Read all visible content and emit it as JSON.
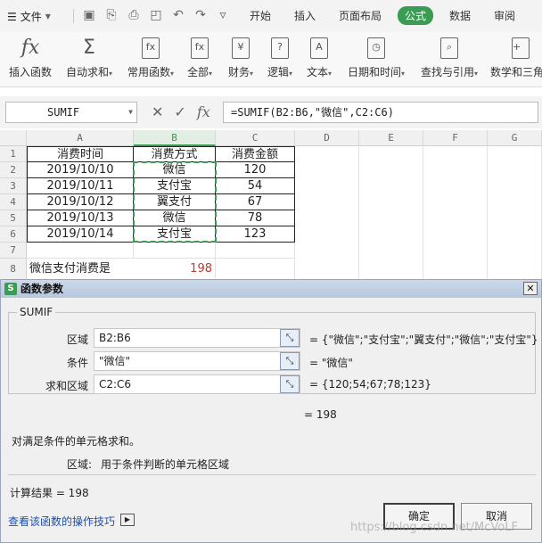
{
  "menubar": {
    "file_label": "文件",
    "tabs": [
      "开始",
      "插入",
      "页面布局",
      "公式",
      "数据",
      "审阅"
    ],
    "active_tab": "公式"
  },
  "ribbon": {
    "buttons": [
      {
        "label": "插入函数",
        "icon": "fx-icon"
      },
      {
        "label": "自动求和",
        "icon": "sigma-icon"
      },
      {
        "label": "常用函数",
        "icon": "star-function-icon"
      },
      {
        "label": "全部",
        "icon": "all-functions-icon"
      },
      {
        "label": "财务",
        "icon": "finance-icon"
      },
      {
        "label": "逻辑",
        "icon": "logic-icon"
      },
      {
        "label": "文本",
        "icon": "text-function-icon"
      },
      {
        "label": "日期和时间",
        "icon": "clock-icon"
      },
      {
        "label": "查找与引用",
        "icon": "lookup-icon"
      },
      {
        "label": "数学和三角",
        "icon": "math-icon"
      }
    ]
  },
  "formula_bar": {
    "name_box": "SUMIF",
    "formula": "=SUMIF(B2:B6,\"微信\",C2:C6)"
  },
  "sheet": {
    "columns": [
      "A",
      "B",
      "C",
      "D",
      "E",
      "F",
      "G"
    ],
    "rows": [
      "1",
      "2",
      "3",
      "4",
      "5",
      "6",
      "7",
      "8"
    ],
    "headers": [
      "消费时间",
      "消费方式",
      "消费金额"
    ],
    "data": [
      [
        "2019/10/10",
        "微信",
        "120"
      ],
      [
        "2019/10/11",
        "支付宝",
        "54"
      ],
      [
        "2019/10/12",
        "翼支付",
        "67"
      ],
      [
        "2019/10/13",
        "微信",
        "78"
      ],
      [
        "2019/10/14",
        "支付宝",
        "123"
      ]
    ],
    "summary_label": "微信支付消费是",
    "summary_value": "198"
  },
  "dialog": {
    "title": "函数参数",
    "function_name": "SUMIF",
    "args": [
      {
        "label": "区域",
        "value": "B2:B6",
        "result": "= {\"微信\";\"支付宝\";\"翼支付\";\"微信\";\"支付宝\"}"
      },
      {
        "label": "条件",
        "value": "\"微信\"",
        "result": "= \"微信\""
      },
      {
        "label": "求和区域",
        "value": "C2:C6",
        "result": "= {120;54;67;78;123}"
      }
    ],
    "formula_result": "= 198",
    "description": "对满足条件的单元格求和。",
    "arg_help_label": "区域:",
    "arg_help_text": "用于条件判断的单元格区域",
    "calc_result": "计算结果 =  198",
    "link": "查看该函数的操作技巧",
    "ok_label": "确定",
    "cancel_label": "取消",
    "watermark": "https://blog.csdn.net/McVoLF"
  }
}
